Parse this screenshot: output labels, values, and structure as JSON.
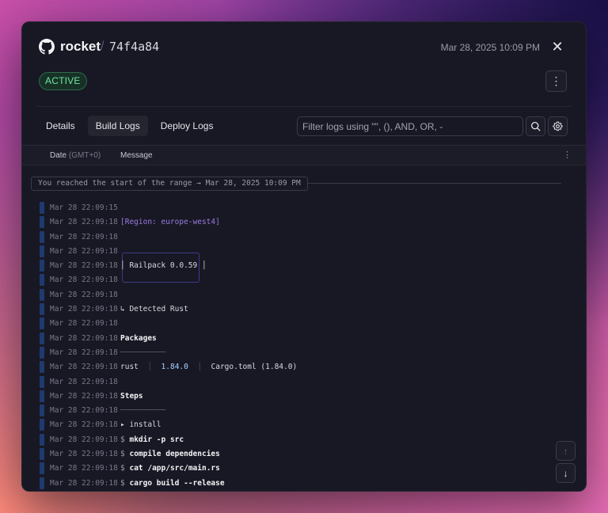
{
  "header": {
    "project": "rocket",
    "separator": "/",
    "deployment_id": "74f4a84",
    "date": "Mar 28, 2025 10:09 PM",
    "close_glyph": "✕",
    "status": "ACTIVE",
    "menu_glyph": "⋮"
  },
  "tabs": [
    {
      "label": "Details"
    },
    {
      "label": "Build Logs"
    },
    {
      "label": "Deploy Logs"
    }
  ],
  "filter": {
    "placeholder": "Filter logs using \"\", (), AND, OR, -"
  },
  "columns": {
    "date": "Date",
    "date_tz": "(GMT+0)",
    "message": "Message",
    "menu_glyph": "⋮"
  },
  "range_notice": "You reached the start of the range → Mar 28, 2025 10:09 PM",
  "logs": [
    {
      "ts": "Mar 28 22:09:15",
      "msg": ""
    },
    {
      "ts": "Mar 28 22:09:18",
      "msg": "[Region: europe-west4]"
    },
    {
      "ts": "Mar 28 22:09:18",
      "msg": ""
    },
    {
      "ts": "Mar 28 22:09:18",
      "msg": ""
    },
    {
      "ts": "Mar 28 22:09:18",
      "msg": "│ Railpack 0.0.59 │"
    },
    {
      "ts": "Mar 28 22:09:18",
      "msg": ""
    },
    {
      "ts": "Mar 28 22:09:18",
      "msg": ""
    },
    {
      "ts": "Mar 28 22:09:18",
      "msg": "↳ Detected Rust"
    },
    {
      "ts": "Mar 28 22:09:18",
      "msg": ""
    },
    {
      "ts": "Mar 28 22:09:18",
      "msg": "Packages"
    },
    {
      "ts": "Mar 28 22:09:18",
      "msg": "──────────"
    },
    {
      "ts": "Mar 28 22:09:18",
      "pkg_name": "rust",
      "pkg_sep": "│",
      "pkg_version": "1.84.0",
      "pkg_sep2": "│",
      "pkg_source": "Cargo.toml (1.84.0)"
    },
    {
      "ts": "Mar 28 22:09:18",
      "msg": ""
    },
    {
      "ts": "Mar 28 22:09:18",
      "msg": "Steps"
    },
    {
      "ts": "Mar 28 22:09:18",
      "msg": "──────────"
    },
    {
      "ts": "Mar 28 22:09:18",
      "msg": "▸ install"
    },
    {
      "ts": "Mar 28 22:09:18",
      "prompt": "$",
      "cmd": "mkdir -p src"
    },
    {
      "ts": "Mar 28 22:09:18",
      "prompt": "$",
      "cmd": "compile dependencies"
    },
    {
      "ts": "Mar 28 22:09:18",
      "prompt": "$",
      "cmd": "cat /app/src/main.rs"
    },
    {
      "ts": "Mar 28 22:09:18",
      "prompt": "$",
      "cmd": "cargo build --release"
    }
  ],
  "scroll": {
    "up_glyph": "↑",
    "down_glyph": "↓"
  },
  "colors": {
    "panel_bg": "#181824",
    "status_green": "#6ee7a4",
    "region_purple": "#9b7be0",
    "log_bar_blue": "#1f3a6e"
  }
}
